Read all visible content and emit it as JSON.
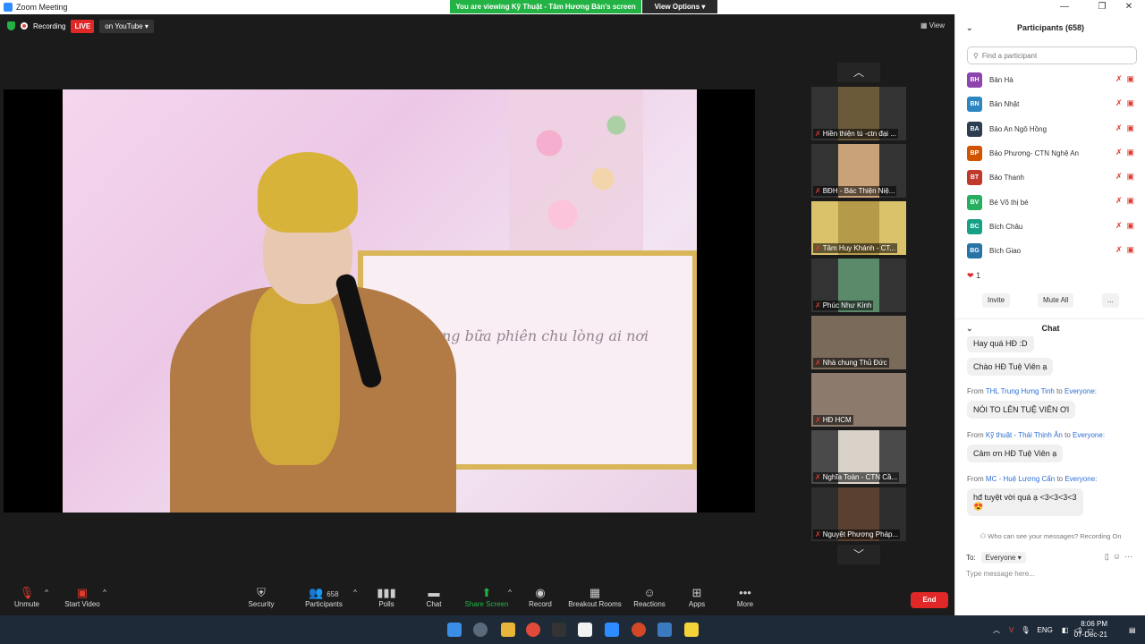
{
  "window": {
    "title": "Zoom Meeting"
  },
  "share_banner": {
    "text": "You are viewing Kỹ Thuật - Tâm Hương Bản's screen",
    "view_options": "View Options ▾"
  },
  "top": {
    "recording": "Recording",
    "live": "LIVE",
    "youtube": "on YouTube ▾",
    "view": "View"
  },
  "shared_content": {
    "calligraphy": "Trong bữa phiên  chu lòng ai nơi ..."
  },
  "filmstrip": [
    {
      "name": "Hiền thiện tú -ctn đại ..."
    },
    {
      "name": "BĐH - Bác Thiện Niệ..."
    },
    {
      "name": "Tâm Huy Khánh - CT..."
    },
    {
      "name": "Phúc Như Kính"
    },
    {
      "name": "Nhà chung Thủ Đức"
    },
    {
      "name": "HĐ HCM"
    },
    {
      "name": "Nghĩa Toàn - CTN Cầ..."
    },
    {
      "name": "Nguyệt Phương Pháp..."
    }
  ],
  "toolbar": {
    "unmute": "Unmute",
    "start_video": "Start Video",
    "security": "Security",
    "participants": "Participants",
    "participants_count": "658",
    "polls": "Polls",
    "chat": "Chat",
    "share_screen": "Share Screen",
    "record": "Record",
    "breakout": "Breakout Rooms",
    "reactions": "Reactions",
    "apps": "Apps",
    "more": "More",
    "end": "End"
  },
  "participants_panel": {
    "title": "Participants (658)",
    "search_placeholder": "Find a participant",
    "items": [
      {
        "initials": "BH",
        "name": "Bản Hà",
        "color": "#8e44ad"
      },
      {
        "initials": "BN",
        "name": "Bản Nhật",
        "color": "#2e86c1"
      },
      {
        "initials": "BA",
        "name": "Bảo An Ngô Hồng",
        "color": "#2c3e50"
      },
      {
        "initials": "BP",
        "name": "Bảo Phương- CTN Nghệ An",
        "color": "#d35400"
      },
      {
        "initials": "BT",
        "name": "Bảo Thanh",
        "color": "#c0392b"
      },
      {
        "initials": "BV",
        "name": "Bé Võ thị bé",
        "color": "#27ae60"
      },
      {
        "initials": "BC",
        "name": "Bích Châu",
        "color": "#16a085"
      },
      {
        "initials": "BG",
        "name": "Bích Giao",
        "color": "#2874a6"
      }
    ],
    "reaction_count": "1",
    "invite": "Invite",
    "mute_all": "Mute All",
    "more": "..."
  },
  "chat": {
    "title": "Chat",
    "messages": [
      {
        "from": "",
        "to": "",
        "text": "Hay quá HĐ :D"
      },
      {
        "from": "",
        "to": "",
        "text": "Chào HĐ Tuệ Viên ạ"
      },
      {
        "from": "THL Trung Hưng Tinh",
        "to": "Everyone:",
        "text": "NÓI TO LÊN TUỆ VIÊN ƠI"
      },
      {
        "from": "Kỹ thuật - Thái Thịnh Ân",
        "to": "Everyone:",
        "text": "Cảm ơn HĐ Tuệ Viên ạ"
      },
      {
        "from": "MC - Huệ Lương Cẩn",
        "to": "Everyone:",
        "text": "hđ tuyệt vời quá ạ <3<3<3<3"
      }
    ],
    "from_word": "From",
    "to_word": "to",
    "emoji": "😍",
    "who_can_see": "Who can see your messages? Recording On",
    "to_label": "To:",
    "to_value": "Everyone ▾",
    "placeholder": "Type message here..."
  },
  "taskbar": {
    "lang": "ENG",
    "time": "8:06 PM",
    "date": "07-Dec-21"
  }
}
